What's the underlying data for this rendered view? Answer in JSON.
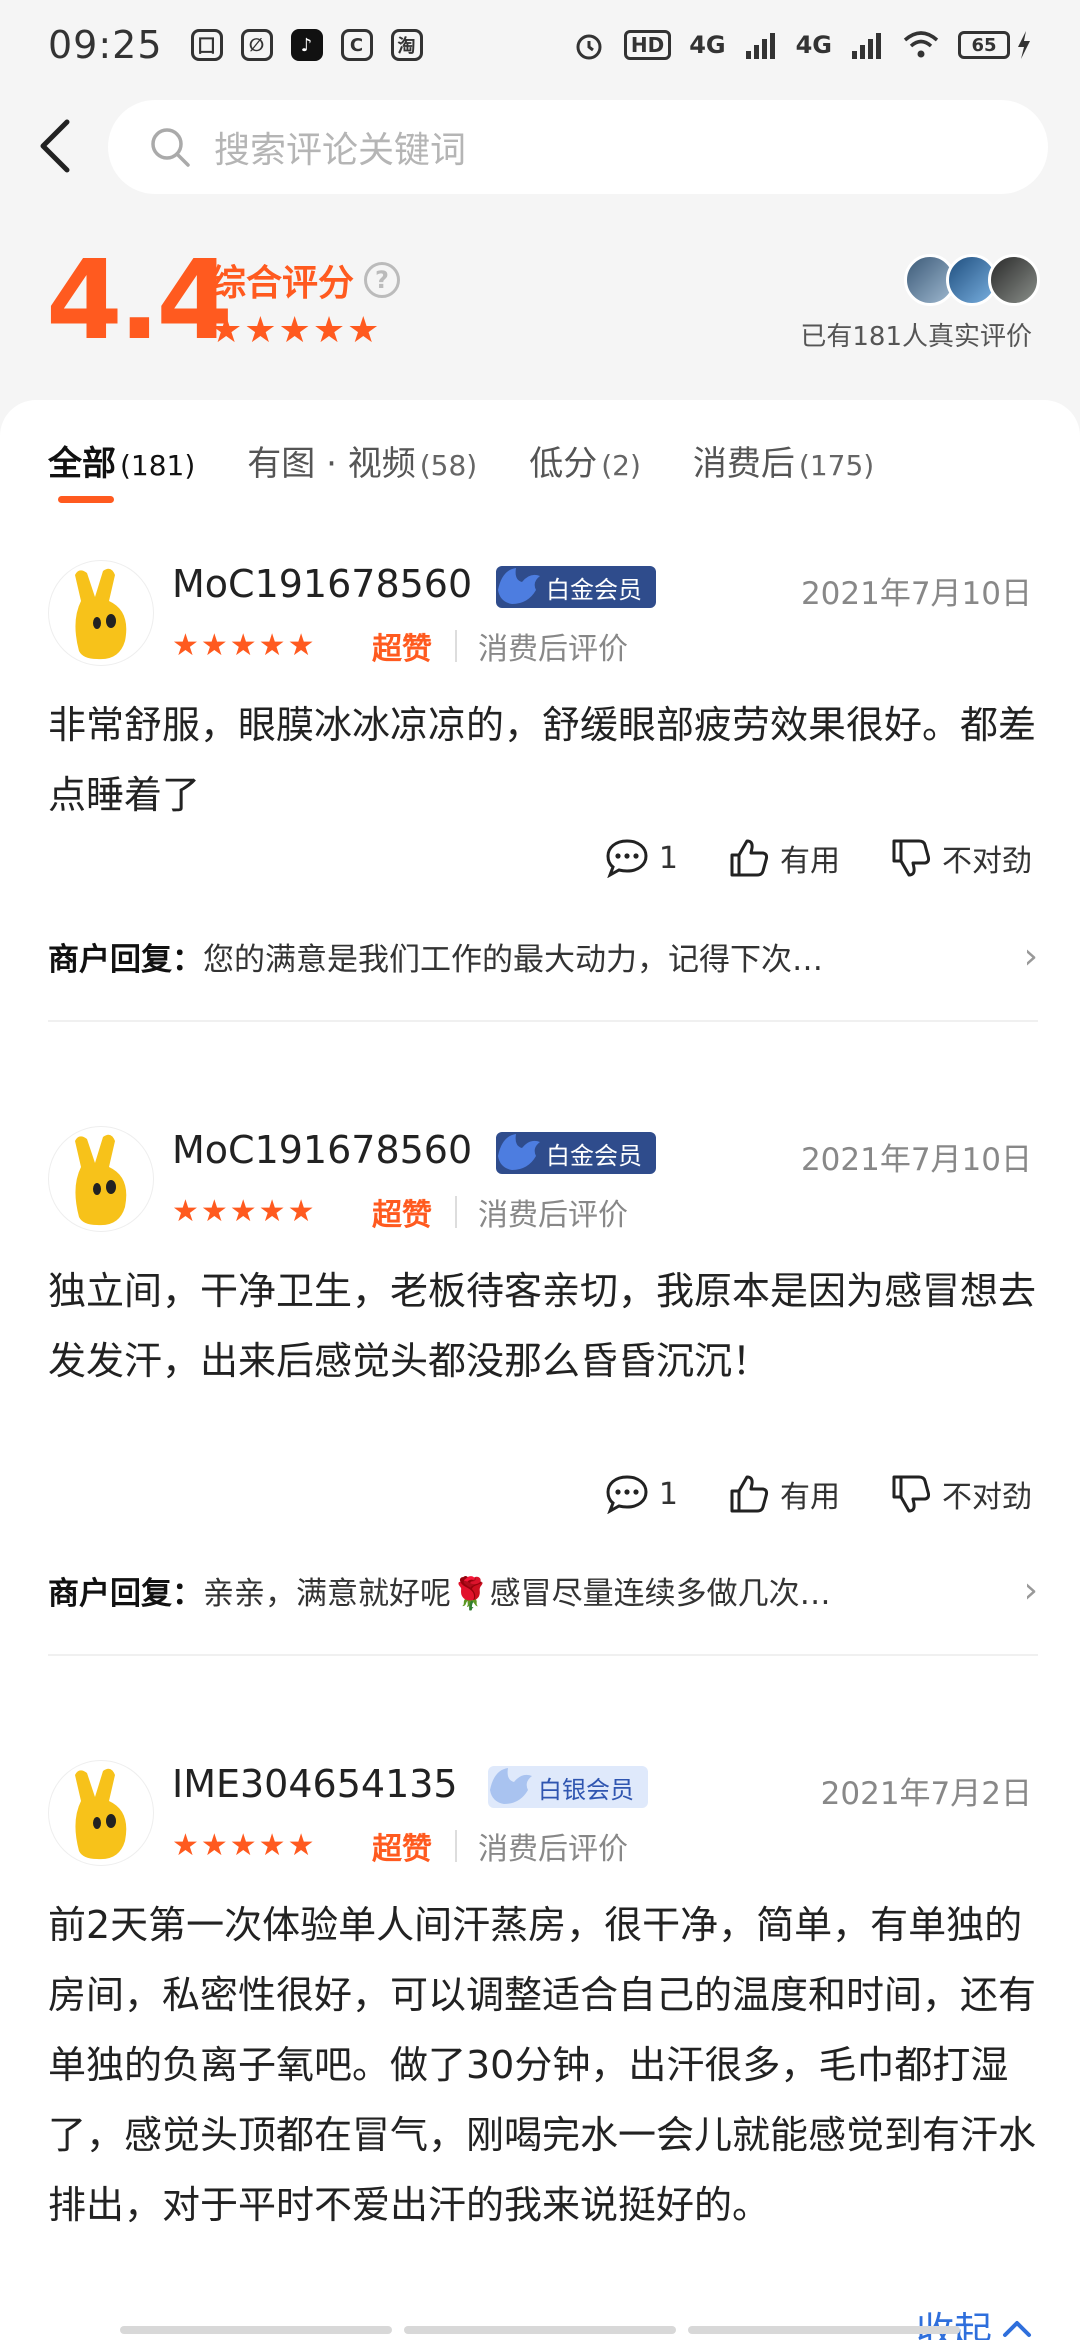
{
  "status_bar": {
    "time": "09:25",
    "battery": "65",
    "signal_1": "4G",
    "signal_2": "4G",
    "hd": "HD",
    "app_icons": [
      "doc-icon",
      "leaf-icon",
      "tiktok-icon",
      "c-icon",
      "taobao-icon"
    ]
  },
  "search": {
    "placeholder": "搜索评论关键词"
  },
  "rating": {
    "score": "4.4",
    "label": "综合评分",
    "stars": "★★★★★",
    "real_count": "已有181人真实评价"
  },
  "tabs": [
    {
      "label": "全部",
      "count": "(181)"
    },
    {
      "label": "有图 · 视频",
      "count": "(58)"
    },
    {
      "label": "低分",
      "count": "(2)"
    },
    {
      "label": "消费后",
      "count": "(175)"
    }
  ],
  "reviews": [
    {
      "name": "MoC191678560",
      "badge": "白金会员",
      "date": "2021年7月10日",
      "stars": "★★★★★",
      "level": "超赞",
      "tag": "消费后评价",
      "text": "非常舒服，眼膜冰冰凉凉的，舒缓眼部疲劳效果很好。都差点睡着了",
      "comments": "1",
      "useful": "有用",
      "not_useful": "不对劲",
      "reply_label": "商户回复：",
      "reply_text": "您的满意是我们工作的最大动力，记得下次…"
    },
    {
      "name": "MoC191678560",
      "badge": "白金会员",
      "date": "2021年7月10日",
      "stars": "★★★★★",
      "level": "超赞",
      "tag": "消费后评价",
      "text": "独立间，干净卫生，老板待客亲切，我原本是因为感冒想去发发汗，出来后感觉头都没那么昏昏沉沉！",
      "comments": "1",
      "useful": "有用",
      "not_useful": "不对劲",
      "reply_label": "商户回复：",
      "reply_text": "亲亲，满意就好呢🌹感冒尽量连续多做几次…"
    },
    {
      "name": "IME304654135",
      "badge": "白银会员",
      "date": "2021年7月2日",
      "stars": "★★★★★",
      "level": "超赞",
      "tag": "消费后评价",
      "text": "前2天第一次体验单人间汗蒸房，很干净，简单，有单独的房间，私密性很好，可以调整适合自己的温度和时间，还有单独的负离子氧吧。做了30分钟，出汗很多，毛巾都打湿了，感觉头顶都在冒气，刚喝完水一会儿就能感觉到有汗水排出，对于平时不爱出汗的我来说挺好的。"
    }
  ],
  "collapse_label": "收起",
  "colors": {
    "accent": "#ff5a1f",
    "link": "#2f6fdc",
    "platinum_badge": "#2f4c8c",
    "silver_badge": "#dfe9fb"
  }
}
